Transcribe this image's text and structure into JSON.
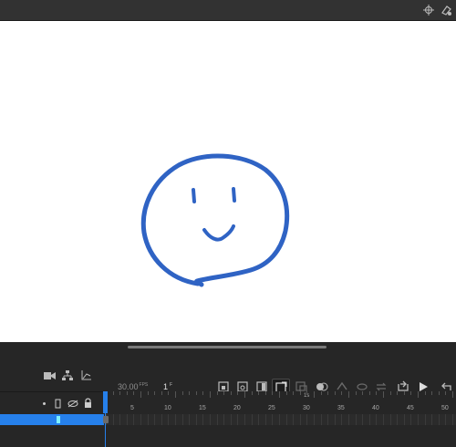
{
  "toolbar": {
    "fps_value": "30.00",
    "fps_unit": "FPS",
    "frame_value": "1",
    "frame_unit": "F"
  },
  "ruler": {
    "labels": [
      "5",
      "10",
      "15",
      "20",
      "25",
      "30",
      "35",
      "40",
      "45",
      "50"
    ],
    "fs_marker": "1s"
  },
  "colors": {
    "accent": "#2680eb",
    "stroke": "#2f63c4",
    "keyframe": "#7ff2ff"
  },
  "icons": [
    "crosshair-icon",
    "palette-icon",
    "camera-icon",
    "hierarchy-icon",
    "graph-icon",
    "insert-keyframe-icon",
    "blank-keyframe-icon",
    "remove-frame-icon",
    "onion-skin-icon",
    "loop-icon",
    "play-icon",
    "rewind-icon",
    "eye-icon",
    "lock-icon",
    "outline-icon"
  ]
}
